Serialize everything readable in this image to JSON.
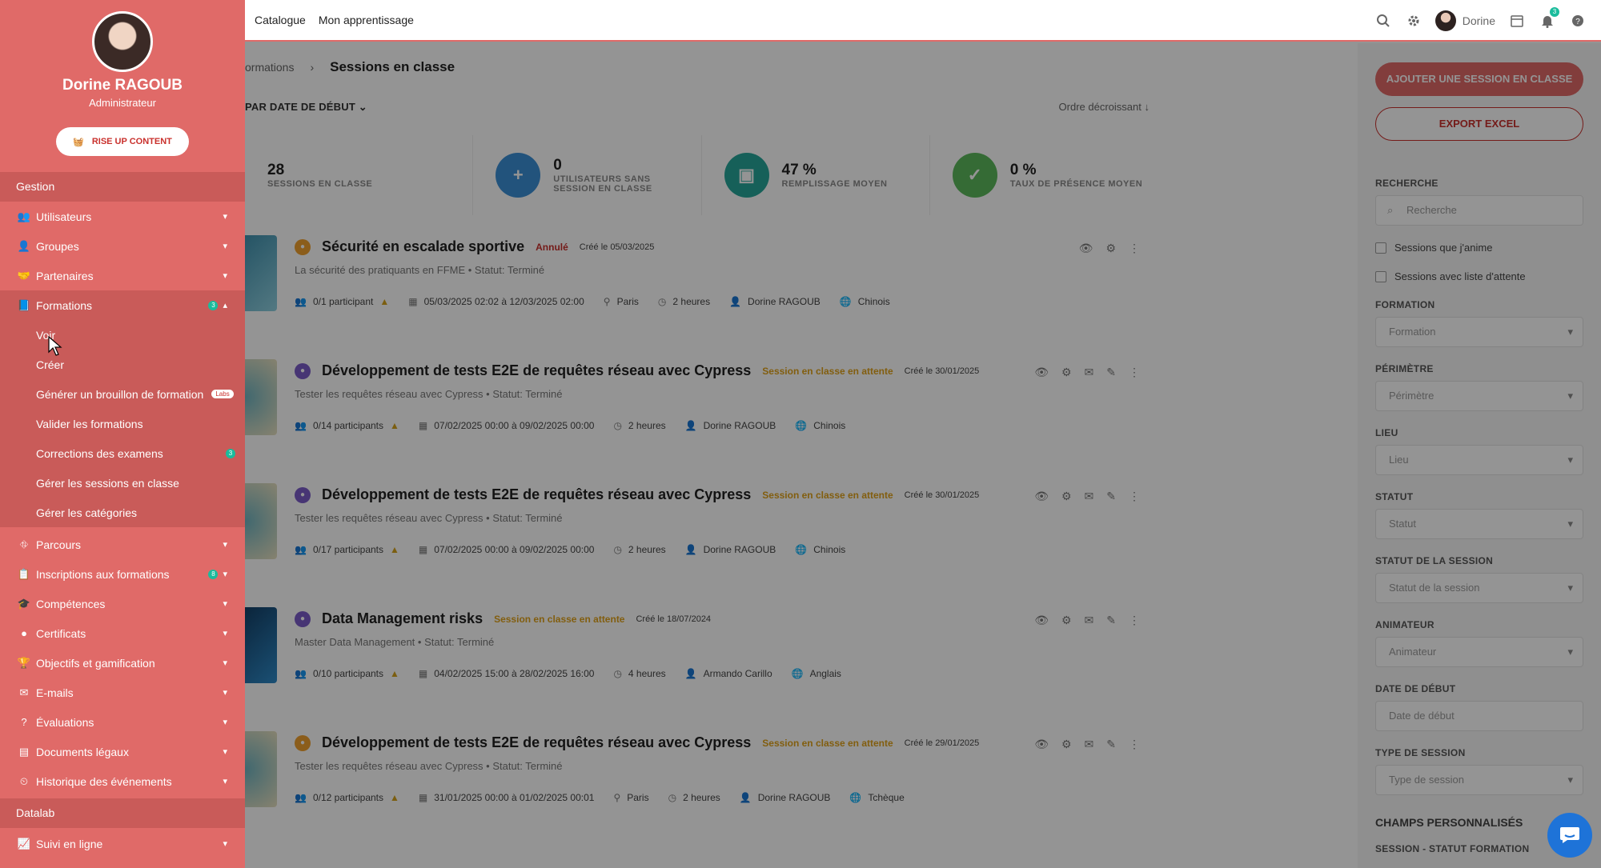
{
  "topbar": {
    "nav": [
      "Catalogue",
      "Mon apprentissage"
    ],
    "user_name": "Dorine",
    "notif_count": "3"
  },
  "breadcrumb": {
    "parent": "ormations",
    "current": "Sessions en classe"
  },
  "sort": {
    "label": "PAR DATE DE DÉBUT",
    "order": "Ordre décroissant"
  },
  "stats": [
    {
      "value": "28",
      "label": "SESSIONS EN CLASSE",
      "color": "",
      "icon": ""
    },
    {
      "value": "0",
      "label": "UTILISATEURS SANS SESSION EN CLASSE",
      "color": "#3b8fd6",
      "icon": "user-plus-icon"
    },
    {
      "value": "47 %",
      "label": "REMPLISSAGE MOYEN",
      "color": "#26a69a",
      "icon": "box-icon"
    },
    {
      "value": "0 %",
      "label": "TAUX DE PRÉSENCE MOYEN",
      "color": "#5cb85c",
      "icon": "user-check-icon"
    }
  ],
  "sessions": [
    {
      "title": "Sécurité en escalade sportive",
      "status": "Annulé",
      "status_color": "#c9302c",
      "created": "Créé le 05/03/2025",
      "subtitle": "La sécurité des pratiquants en FFME  •  Statut: Terminé",
      "participants": "0/1 participant",
      "dates": "05/03/2025 02:02 à 12/03/2025 02:00",
      "location": "Paris",
      "duration": "2 heures",
      "trainer": "Dorine RAGOUB",
      "language": "Chinois"
    },
    {
      "title": "Développement de tests E2E de requêtes réseau avec Cypress",
      "status": "Session en classe en attente",
      "status_color": "#e0a21a",
      "created": "Créé le 30/01/2025",
      "subtitle": "Tester les requêtes réseau avec Cypress  •  Statut: Terminé",
      "participants": "0/14 participants",
      "dates": "07/02/2025 00:00 à 09/02/2025 00:00",
      "location": "",
      "duration": "2 heures",
      "trainer": "Dorine RAGOUB",
      "language": "Chinois"
    },
    {
      "title": "Développement de tests E2E de requêtes réseau avec Cypress",
      "status": "Session en classe en attente",
      "status_color": "#e0a21a",
      "created": "Créé le 30/01/2025",
      "subtitle": "Tester les requêtes réseau avec Cypress  •  Statut: Terminé",
      "participants": "0/17 participants",
      "dates": "07/02/2025 00:00 à 09/02/2025 00:00",
      "location": "",
      "duration": "2 heures",
      "trainer": "Dorine RAGOUB",
      "language": "Chinois"
    },
    {
      "title": "Data Management risks",
      "status": "Session en classe en attente",
      "status_color": "#e0a21a",
      "created": "Créé le 18/07/2024",
      "subtitle": "Master Data Management  •  Statut: Terminé",
      "participants": "0/10 participants",
      "dates": "04/02/2025 15:00 à 28/02/2025 16:00",
      "location": "",
      "duration": "4 heures",
      "trainer": "Armando Carillo",
      "language": "Anglais"
    },
    {
      "title": "Développement de tests E2E de requêtes réseau avec Cypress",
      "status": "Session en classe en attente",
      "status_color": "#e0a21a",
      "created": "Créé le 29/01/2025",
      "subtitle": "Tester les requêtes réseau avec Cypress  •  Statut: Terminé",
      "participants": "0/12 participants",
      "dates": "31/01/2025 00:00 à 01/02/2025 00:01",
      "location": "Paris",
      "duration": "2 heures",
      "trainer": "Dorine RAGOUB",
      "language": "Tchèque"
    }
  ],
  "filters": {
    "add_button": "AJOUTER UNE SESSION EN CLASSE",
    "export_button": "EXPORT EXCEL",
    "search_label": "RECHERCHE",
    "search_placeholder": "Recherche",
    "check1": "Sessions que j'anime",
    "check2": "Sessions avec liste d'attente",
    "fields": [
      {
        "label": "FORMATION",
        "placeholder": "Formation"
      },
      {
        "label": "PÉRIMÈTRE",
        "placeholder": "Périmètre"
      },
      {
        "label": "LIEU",
        "placeholder": "Lieu"
      },
      {
        "label": "STATUT",
        "placeholder": "Statut"
      },
      {
        "label": "STATUT DE LA SESSION",
        "placeholder": "Statut de la session"
      },
      {
        "label": "ANIMATEUR",
        "placeholder": "Animateur"
      },
      {
        "label": "DATE DE DÉBUT",
        "placeholder": "Date de début"
      },
      {
        "label": "TYPE DE SESSION",
        "placeholder": "Type de session"
      }
    ],
    "custom_fields": "CHAMPS PERSONNALISÉS",
    "custom_sub": "SESSION - STATUT FORMATION"
  },
  "sidebar": {
    "user_name": "Dorine RAGOUB",
    "user_role": "Administrateur",
    "rise_button": "RISE UP CONTENT",
    "section_gestion": "Gestion",
    "items": [
      {
        "label": "Utilisateurs",
        "icon": "users-icon"
      },
      {
        "label": "Groupes",
        "icon": "group-icon"
      },
      {
        "label": "Partenaires",
        "icon": "handshake-icon"
      },
      {
        "label": "Formations",
        "icon": "book-icon",
        "badge": "3"
      }
    ],
    "subitems": [
      "Voir",
      "Créer",
      "Générer un brouillon de formation",
      "Valider les formations",
      "Corrections des examens",
      "Gérer les sessions en classe",
      "Gérer les catégories"
    ],
    "labs_badge": "Labs",
    "corrections_badge": "3",
    "items2": [
      {
        "label": "Parcours",
        "icon": "sitemap-icon"
      },
      {
        "label": "Inscriptions aux formations",
        "icon": "register-icon",
        "badge": "8"
      },
      {
        "label": "Compétences",
        "icon": "skills-icon"
      },
      {
        "label": "Certificats",
        "icon": "certificate-icon"
      },
      {
        "label": "Objectifs et gamification",
        "icon": "trophy-icon"
      },
      {
        "label": "E-mails",
        "icon": "mail-icon"
      },
      {
        "label": "Évaluations",
        "icon": "question-icon"
      },
      {
        "label": "Documents légaux",
        "icon": "document-icon"
      },
      {
        "label": "Historique des événements",
        "icon": "history-icon"
      }
    ],
    "section_datalab": "Datalab",
    "items3": [
      {
        "label": "Suivi en ligne",
        "icon": "chart-icon"
      }
    ]
  }
}
